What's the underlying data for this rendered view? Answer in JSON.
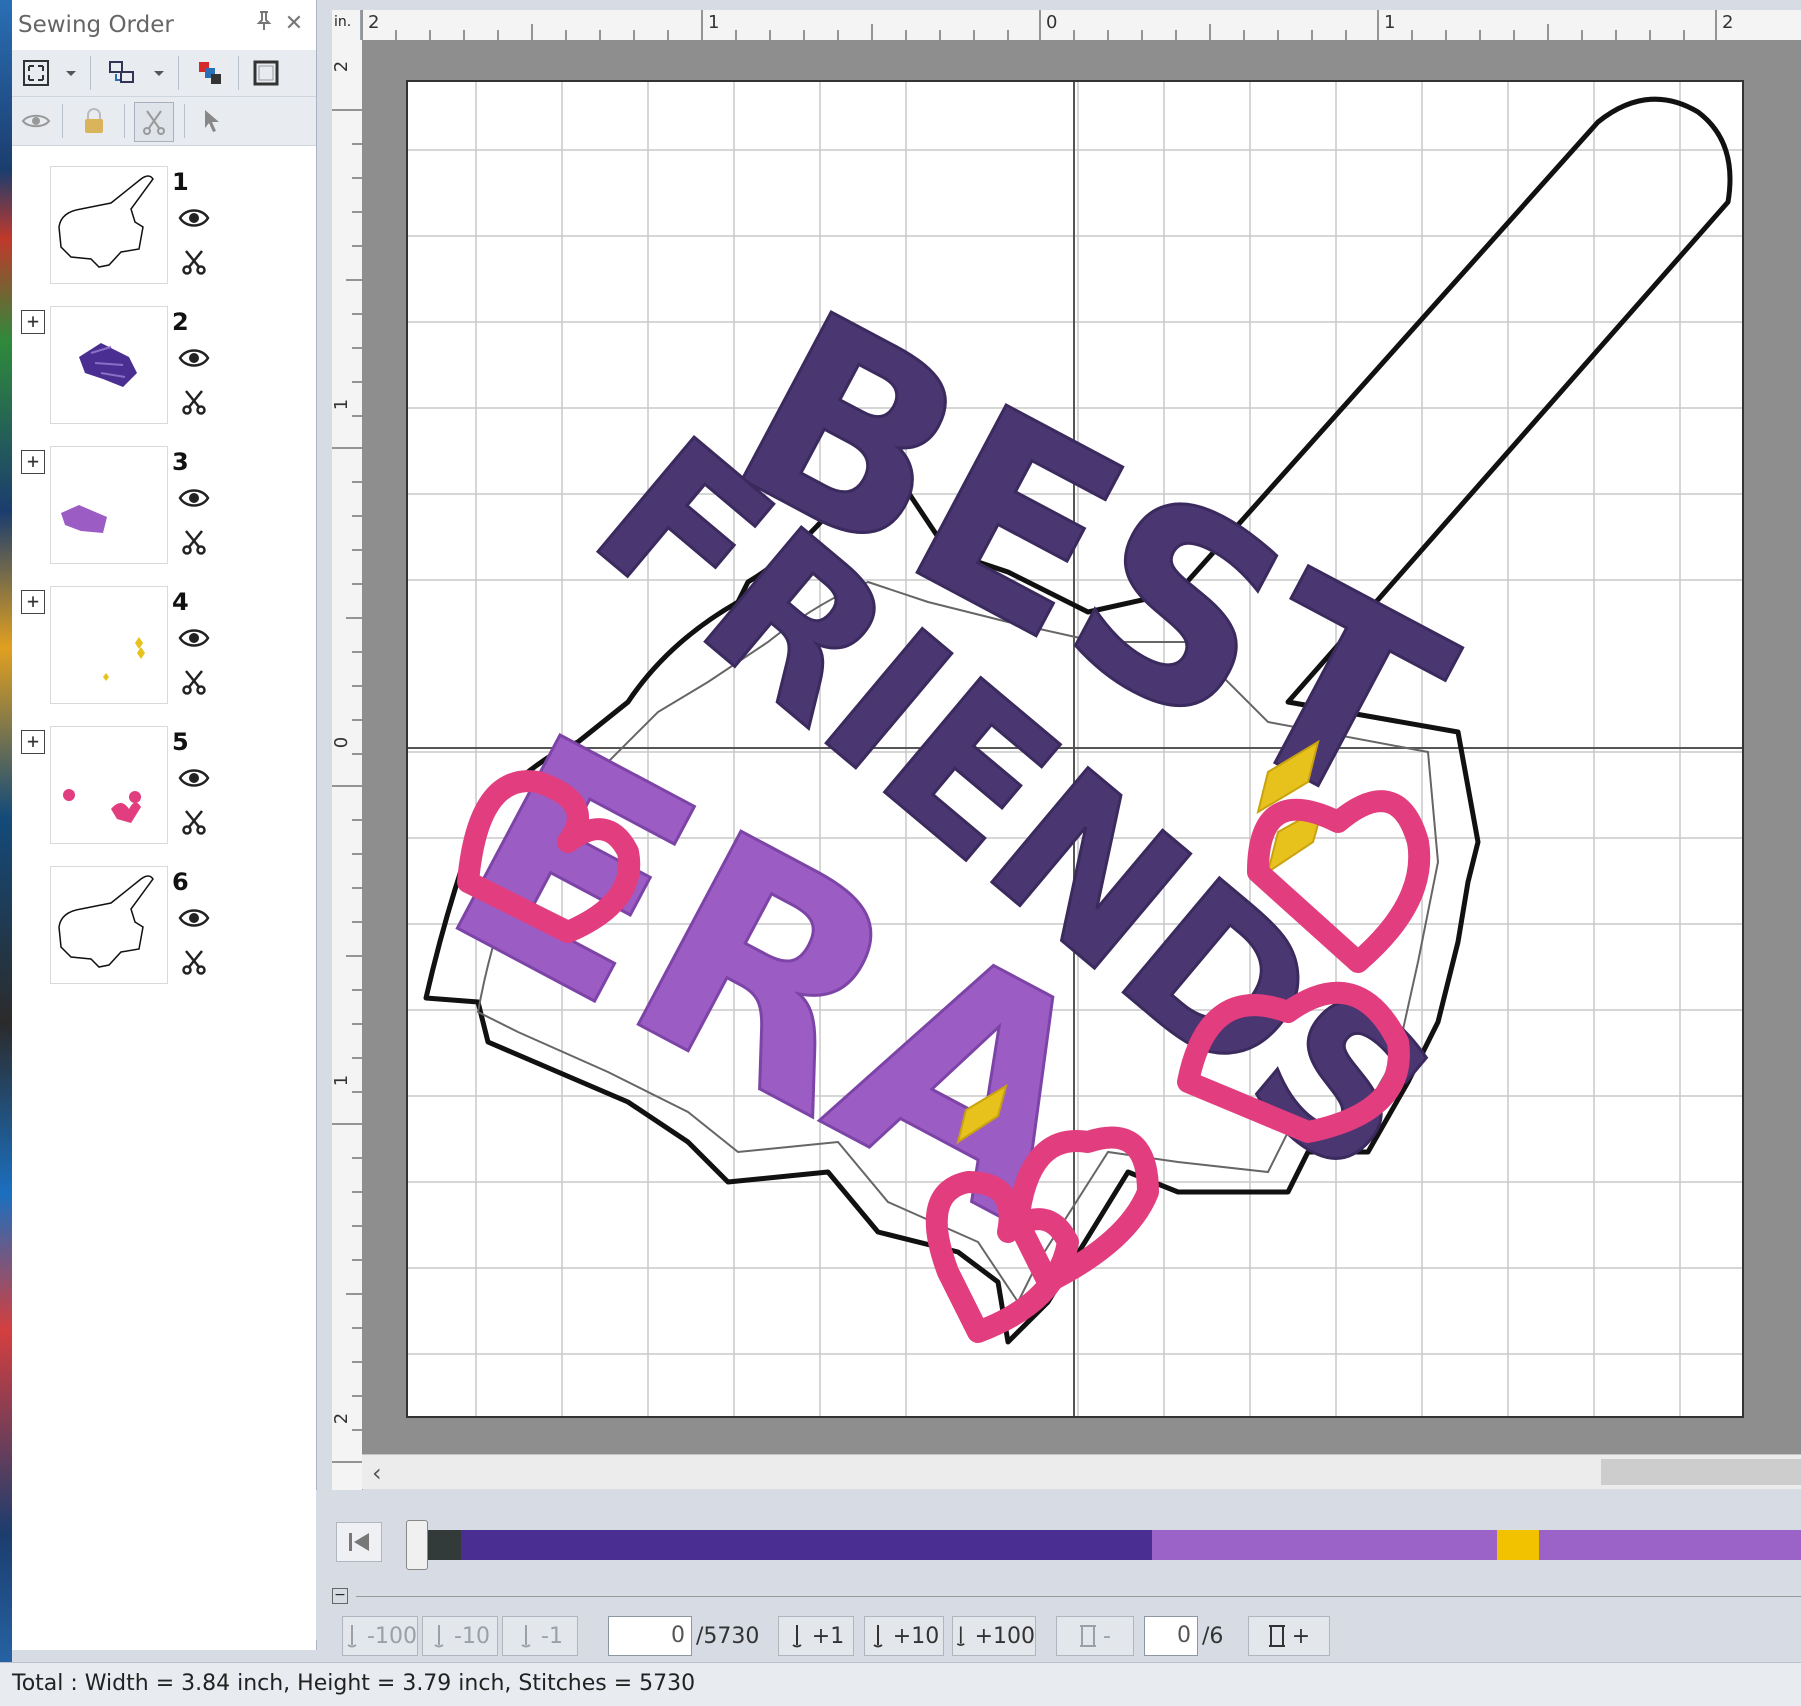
{
  "panel": {
    "title": "Sewing Order",
    "pin_glyph": "📌",
    "close_glyph": "✕",
    "items": [
      {
        "number": "1",
        "has_expand": false,
        "thumb": "outline"
      },
      {
        "number": "2",
        "has_expand": true,
        "thumb": "dark-purple-text"
      },
      {
        "number": "3",
        "has_expand": true,
        "thumb": "purple-text"
      },
      {
        "number": "4",
        "has_expand": true,
        "thumb": "yellow-diamonds"
      },
      {
        "number": "5",
        "has_expand": true,
        "thumb": "pink-hearts"
      },
      {
        "number": "6",
        "has_expand": false,
        "thumb": "outline"
      }
    ],
    "expand_glyph": "+"
  },
  "ruler": {
    "unit": "in.",
    "top_ticks": [
      "2",
      "1",
      "0",
      "1",
      "2"
    ],
    "left_ticks": [
      "2",
      "1",
      "0",
      "1",
      "2"
    ]
  },
  "design": {
    "line1": "BEST",
    "line2": "FRIENDS",
    "line3": "ERA"
  },
  "colors": {
    "dark_purple": "#4a3670",
    "light_purple": "#9b5cc4",
    "pink": "#e23d7e",
    "yellow": "#e8c21c",
    "outline": "#111111"
  },
  "progress": {
    "current": 0,
    "segments": [
      {
        "color": "#333a3a",
        "fraction": 0.03
      },
      {
        "color": "#4a2e91",
        "fraction": 0.5
      },
      {
        "color": "#9b63c7",
        "fraction": 0.25
      },
      {
        "color": "#f2c200",
        "fraction": 0.03
      },
      {
        "color": "#9b63c7",
        "fraction": 0.19
      }
    ]
  },
  "stitch_controls": {
    "minus100": "-100",
    "minus10": "-10",
    "minus1": "-1",
    "stitch_value": "0",
    "stitch_total": "/5730",
    "plus1": "+1",
    "plus10": "+10",
    "plus100": "+100",
    "color_minus": "-",
    "color_value": "0",
    "color_total": "/6",
    "color_plus": "+"
  },
  "status": {
    "text": "Total : Width = 3.84 inch, Height = 3.79 inch, Stitches = 5730"
  }
}
